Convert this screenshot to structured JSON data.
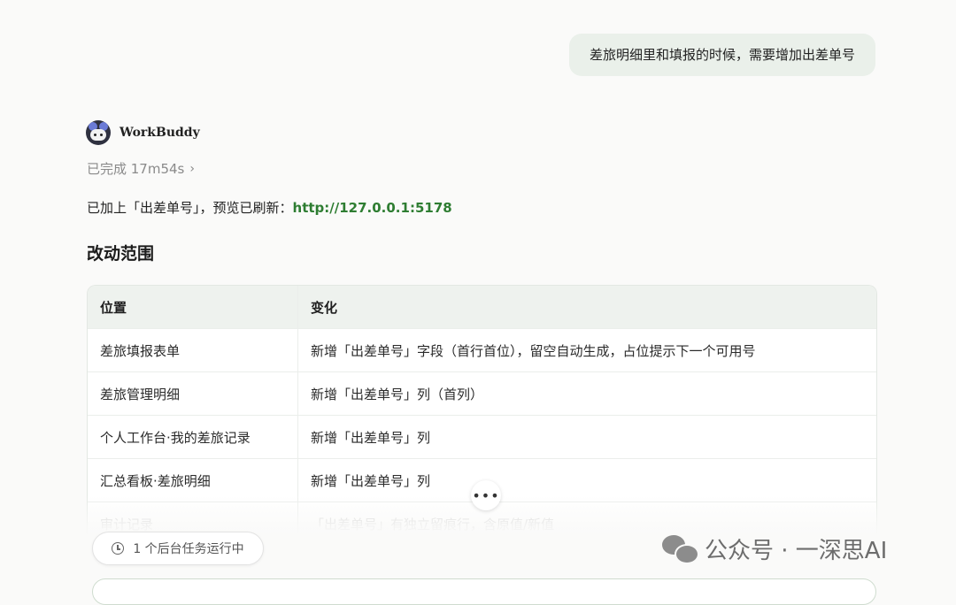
{
  "user_message": "差旅明细里和填报的时候，需要增加出差单号",
  "agent": {
    "name": "WorkBuddy",
    "status": "已完成 17m54s",
    "reply_prefix": "已加上「出差单号」，预览已刷新：",
    "preview_url": "http://127.0.0.1:5178"
  },
  "section_title": "改动范围",
  "table": {
    "headers": [
      "位置",
      "变化"
    ],
    "rows": [
      [
        "差旅填报表单",
        "新增「出差单号」字段（首行首位），留空自动生成，占位提示下一个可用号"
      ],
      [
        "差旅管理明细",
        "新增「出差单号」列（首列）"
      ],
      [
        "个人工作台·我的差旅记录",
        "新增「出差单号」列"
      ],
      [
        "汇总看板·差旅明细",
        "新增「出差单号」列"
      ],
      [
        "审计记录",
        "「出差单号」有独立留痕行，含原值/新值"
      ]
    ]
  },
  "more_button": "•••",
  "background_tasks": "1 个后台任务运行中",
  "watermark": "公众号 · 一深思AI",
  "icons": {
    "avatar": "robot-avatar-icon",
    "status": "chevron-right-icon",
    "tasks": "clock-icon",
    "watermark": "wechat-icon"
  }
}
